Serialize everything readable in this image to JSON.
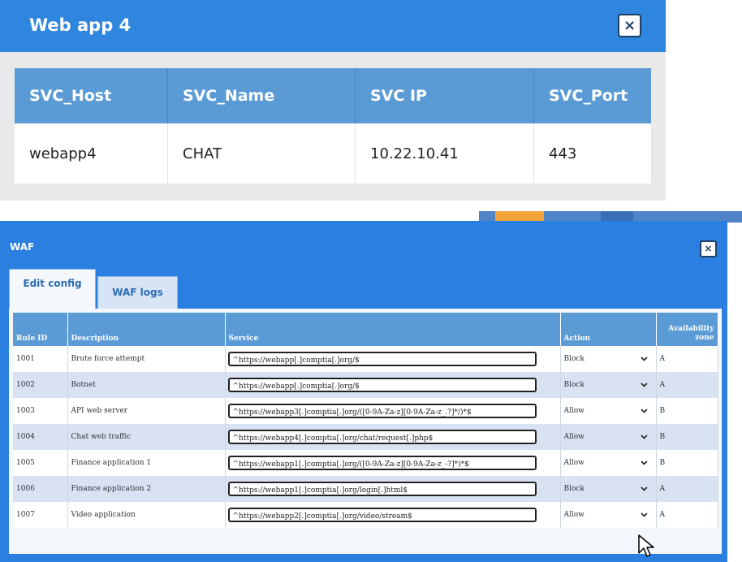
{
  "webapp_dialog": {
    "title": "Web app 4",
    "close_label": "×",
    "headers": [
      "SVC_Host",
      "SVC_Name",
      "SVC IP",
      "SVC_Port"
    ],
    "row": [
      "webapp4",
      "CHAT",
      "10.22.10.41",
      "443"
    ]
  },
  "waf_dialog": {
    "title": "WAF",
    "close_label": "×",
    "tabs": [
      {
        "label": "Edit config",
        "active": true
      },
      {
        "label": "WAF logs",
        "active": false
      }
    ],
    "headers": {
      "rule_id": "Rule ID",
      "description": "Description",
      "service": "Service",
      "action": "Action",
      "zone_line1": "Availability",
      "zone_line2": "zone"
    },
    "rules": [
      {
        "id": "1001",
        "description": "Brute force attempt",
        "service": "^https://webapp[.]comptia[.]org/$",
        "action": "Block",
        "zone": "A"
      },
      {
        "id": "1002",
        "description": "Botnet",
        "service": "^https://webapp[.]comptia[.]org/$",
        "action": "Block",
        "zone": "A"
      },
      {
        "id": "1003",
        "description": "API web server",
        "service": "^https://webapp3[.]comptia[.]org/([0-9A-Za-z][0-9A-Za-z_.?]*/)*$",
        "action": "Allow",
        "zone": "B"
      },
      {
        "id": "1004",
        "description": "Chat web traffic",
        "service": "^https://webapp4[.]comptia[.]org/chat/request[.]php$",
        "action": "Allow",
        "zone": "B"
      },
      {
        "id": "1005",
        "description": "Finance application 1",
        "service": "^https://webapp1[.]comptia[.]org/([0-9A-Za-z][0-9A-Za-z_-?]*)*$",
        "action": "Allow",
        "zone": "B"
      },
      {
        "id": "1006",
        "description": "Finance application 2",
        "service": "^https://webapp1[.]comptia[.]org/login[.]html$",
        "action": "Block",
        "zone": "A"
      },
      {
        "id": "1007",
        "description": "Video application",
        "service": "^https://webapp2[.]comptia[.]org/video/stream$",
        "action": "Allow",
        "zone": "A"
      }
    ]
  },
  "icons": {
    "close": "close-icon",
    "dropdown": "chevron-down-icon",
    "pointer": "mouse-pointer-icon"
  },
  "colors": {
    "title_bar": "#2f86de",
    "table_header": "#5b9bd5",
    "row_alt": "#d9e2f3",
    "tab_text": "#2c6cb5"
  }
}
